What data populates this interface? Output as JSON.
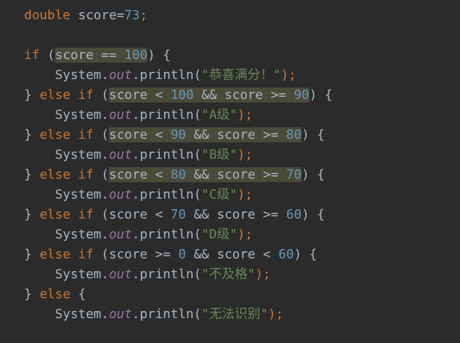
{
  "editor": {
    "language": "java",
    "colors": {
      "background": "#2b2b2b",
      "text": "#a9b7c6",
      "keyword": "#cc7832",
      "number": "#6897bb",
      "string": "#6a8759",
      "field": "#9876aa",
      "highlight": "#4a4a38"
    },
    "lines": [
      {
        "tokens": [
          {
            "t": "double",
            "c": "kw"
          },
          {
            "t": " score=",
            "c": ""
          },
          {
            "t": "73",
            "c": "num"
          },
          {
            "t": ";",
            "c": "kw"
          }
        ]
      },
      {
        "tokens": []
      },
      {
        "tokens": [
          {
            "t": "if",
            "c": "kw"
          },
          {
            "t": " (",
            "c": ""
          },
          {
            "t": "score == ",
            "c": "hl"
          },
          {
            "t": "100",
            "c": "num hl"
          },
          {
            "t": ") {",
            "c": ""
          }
        ]
      },
      {
        "tokens": [
          {
            "t": "    System.",
            "c": ""
          },
          {
            "t": "out",
            "c": "field"
          },
          {
            "t": ".println(",
            "c": ""
          },
          {
            "t": "\"恭喜满分！\"",
            "c": "str"
          },
          {
            "t": ");",
            "c": "kw"
          }
        ]
      },
      {
        "tokens": [
          {
            "t": "} ",
            "c": ""
          },
          {
            "t": "else if",
            "c": "kw"
          },
          {
            "t": " (",
            "c": ""
          },
          {
            "t": "score < ",
            "c": "hl"
          },
          {
            "t": "100",
            "c": "num hl"
          },
          {
            "t": " && score >= ",
            "c": "hl"
          },
          {
            "t": "90",
            "c": "num hl"
          },
          {
            "t": ") {",
            "c": ""
          }
        ]
      },
      {
        "tokens": [
          {
            "t": "    System.",
            "c": ""
          },
          {
            "t": "out",
            "c": "field"
          },
          {
            "t": ".println(",
            "c": ""
          },
          {
            "t": "\"A级\"",
            "c": "str"
          },
          {
            "t": ");",
            "c": "kw"
          }
        ]
      },
      {
        "tokens": [
          {
            "t": "} ",
            "c": ""
          },
          {
            "t": "else if",
            "c": "kw"
          },
          {
            "t": " (",
            "c": ""
          },
          {
            "t": "score < ",
            "c": "hl"
          },
          {
            "t": "90",
            "c": "num hl"
          },
          {
            "t": " && score >= ",
            "c": "hl"
          },
          {
            "t": "80",
            "c": "num hl"
          },
          {
            "t": ") {",
            "c": ""
          }
        ]
      },
      {
        "tokens": [
          {
            "t": "    System.",
            "c": ""
          },
          {
            "t": "out",
            "c": "field"
          },
          {
            "t": ".println(",
            "c": ""
          },
          {
            "t": "\"B级\"",
            "c": "str"
          },
          {
            "t": ");",
            "c": "kw"
          }
        ]
      },
      {
        "tokens": [
          {
            "t": "} ",
            "c": ""
          },
          {
            "t": "else if",
            "c": "kw"
          },
          {
            "t": " (",
            "c": ""
          },
          {
            "t": "score < ",
            "c": "hl"
          },
          {
            "t": "80",
            "c": "num hl"
          },
          {
            "t": " && score >= ",
            "c": "hl"
          },
          {
            "t": "70",
            "c": "num hl"
          },
          {
            "t": ") {",
            "c": ""
          }
        ]
      },
      {
        "tokens": [
          {
            "t": "    System.",
            "c": ""
          },
          {
            "t": "out",
            "c": "field"
          },
          {
            "t": ".println(",
            "c": ""
          },
          {
            "t": "\"C级\"",
            "c": "str"
          },
          {
            "t": ");",
            "c": "kw"
          }
        ]
      },
      {
        "tokens": [
          {
            "t": "} ",
            "c": ""
          },
          {
            "t": "else if",
            "c": "kw"
          },
          {
            "t": " (score < ",
            "c": ""
          },
          {
            "t": "70",
            "c": "num"
          },
          {
            "t": " && score >= ",
            "c": ""
          },
          {
            "t": "60",
            "c": "num"
          },
          {
            "t": ") {",
            "c": ""
          }
        ]
      },
      {
        "tokens": [
          {
            "t": "    System.",
            "c": ""
          },
          {
            "t": "out",
            "c": "field"
          },
          {
            "t": ".println(",
            "c": ""
          },
          {
            "t": "\"D级\"",
            "c": "str"
          },
          {
            "t": ");",
            "c": "kw"
          }
        ]
      },
      {
        "tokens": [
          {
            "t": "} ",
            "c": ""
          },
          {
            "t": "else if",
            "c": "kw"
          },
          {
            "t": " (score >= ",
            "c": ""
          },
          {
            "t": "0",
            "c": "num"
          },
          {
            "t": " && score < ",
            "c": ""
          },
          {
            "t": "60",
            "c": "num"
          },
          {
            "t": ") {",
            "c": ""
          }
        ]
      },
      {
        "tokens": [
          {
            "t": "    System.",
            "c": ""
          },
          {
            "t": "out",
            "c": "field"
          },
          {
            "t": ".println(",
            "c": ""
          },
          {
            "t": "\"不及格\"",
            "c": "str"
          },
          {
            "t": ");",
            "c": "kw"
          }
        ]
      },
      {
        "tokens": [
          {
            "t": "} ",
            "c": ""
          },
          {
            "t": "else",
            "c": "kw"
          },
          {
            "t": " {",
            "c": ""
          }
        ]
      },
      {
        "tokens": [
          {
            "t": "    System.",
            "c": ""
          },
          {
            "t": "out",
            "c": "field"
          },
          {
            "t": ".println(",
            "c": ""
          },
          {
            "t": "\"无法识别\"",
            "c": "str"
          },
          {
            "t": ");",
            "c": "kw"
          }
        ]
      }
    ]
  }
}
